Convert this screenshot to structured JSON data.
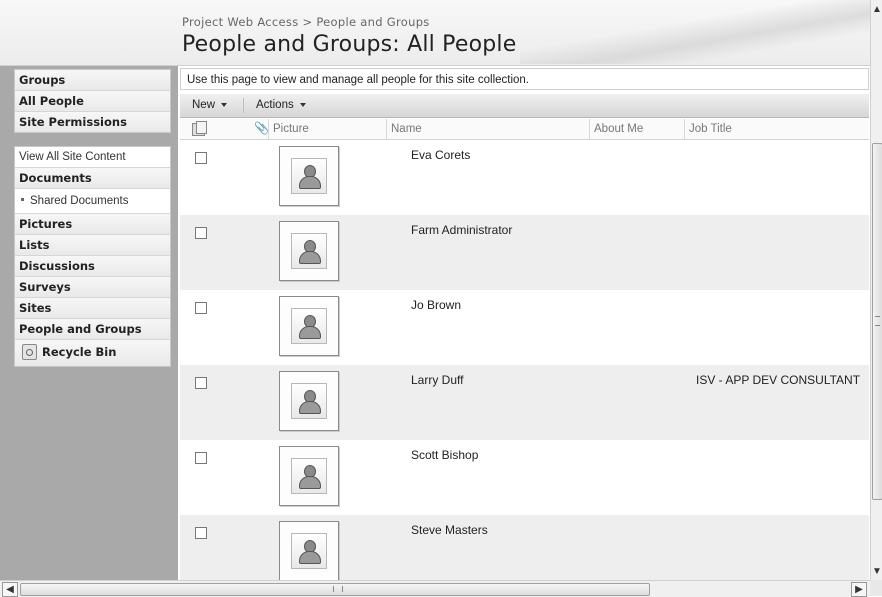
{
  "header": {
    "breadcrumb": "Project Web Access > People and Groups",
    "title": "People and Groups: All People"
  },
  "leftnav": {
    "group1": [
      "Groups",
      "All People",
      "Site Permissions"
    ],
    "view_all": "View All Site Content",
    "documents": "Documents",
    "shared_documents": "Shared Documents",
    "group2": [
      "Pictures",
      "Lists",
      "Discussions",
      "Surveys",
      "Sites",
      "People and Groups"
    ],
    "recycle_bin": "Recycle Bin"
  },
  "main": {
    "description": "Use this page to view and manage all people for this site collection."
  },
  "toolbar": {
    "new_label": "New",
    "actions_label": "Actions"
  },
  "columns": {
    "picture": "Picture",
    "name": "Name",
    "about_me": "About Me",
    "job_title": "Job Title"
  },
  "people": [
    {
      "name": "Eva Corets",
      "job_title": ""
    },
    {
      "name": "Farm Administrator",
      "job_title": ""
    },
    {
      "name": "Jo Brown",
      "job_title": ""
    },
    {
      "name": "Larry Duff",
      "job_title": "ISV - APP DEV CONSULTANT"
    },
    {
      "name": "Scott Bishop",
      "job_title": ""
    },
    {
      "name": "Steve Masters",
      "job_title": ""
    }
  ],
  "icons": {
    "attachment": "paperclip-icon",
    "recycle": "recycle-bin-icon",
    "picture": "person-placeholder-icon"
  }
}
